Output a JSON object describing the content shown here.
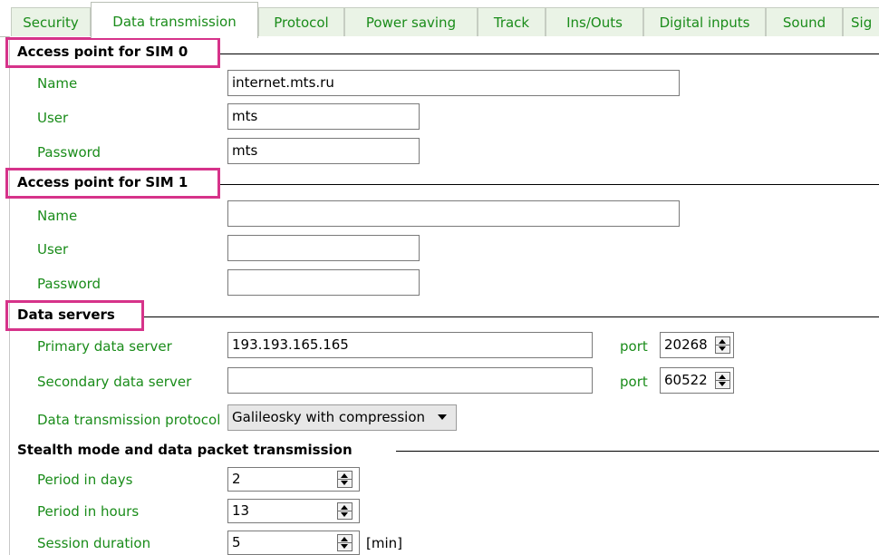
{
  "tabs": [
    {
      "label": "Security"
    },
    {
      "label": "Data transmission"
    },
    {
      "label": "Protocol"
    },
    {
      "label": "Power saving"
    },
    {
      "label": "Track"
    },
    {
      "label": "Ins/Outs"
    },
    {
      "label": "Digital inputs"
    },
    {
      "label": "Sound"
    },
    {
      "label": "Sig"
    }
  ],
  "active_tab": "Data transmission",
  "sim0": {
    "title": "Access point for SIM 0",
    "name_label": "Name",
    "name_value": "internet.mts.ru",
    "user_label": "User",
    "user_value": "mts",
    "password_label": "Password",
    "password_value": "mts"
  },
  "sim1": {
    "title": "Access point for SIM 1",
    "name_label": "Name",
    "name_value": "",
    "user_label": "User",
    "user_value": "",
    "password_label": "Password",
    "password_value": ""
  },
  "servers": {
    "title": "Data servers",
    "primary_label": "Primary data server",
    "primary_value": "193.193.165.165",
    "primary_port_label": "port",
    "primary_port_value": "20268",
    "secondary_label": "Secondary data server",
    "secondary_value": "",
    "secondary_port_label": "port",
    "secondary_port_value": "60522",
    "protocol_label": "Data transmission protocol",
    "protocol_value": "Galileosky with compression"
  },
  "stealth": {
    "title": "Stealth mode and data packet transmission",
    "days_label": "Period in days",
    "days_value": "2",
    "hours_label": "Period in hours",
    "hours_value": "13",
    "session_label": "Session duration",
    "session_value": "5",
    "session_unit": "[min]"
  },
  "colors": {
    "label_green": "#1a8c1a",
    "highlight": "#d6338a",
    "tab_bg": "#eaf3e6"
  }
}
